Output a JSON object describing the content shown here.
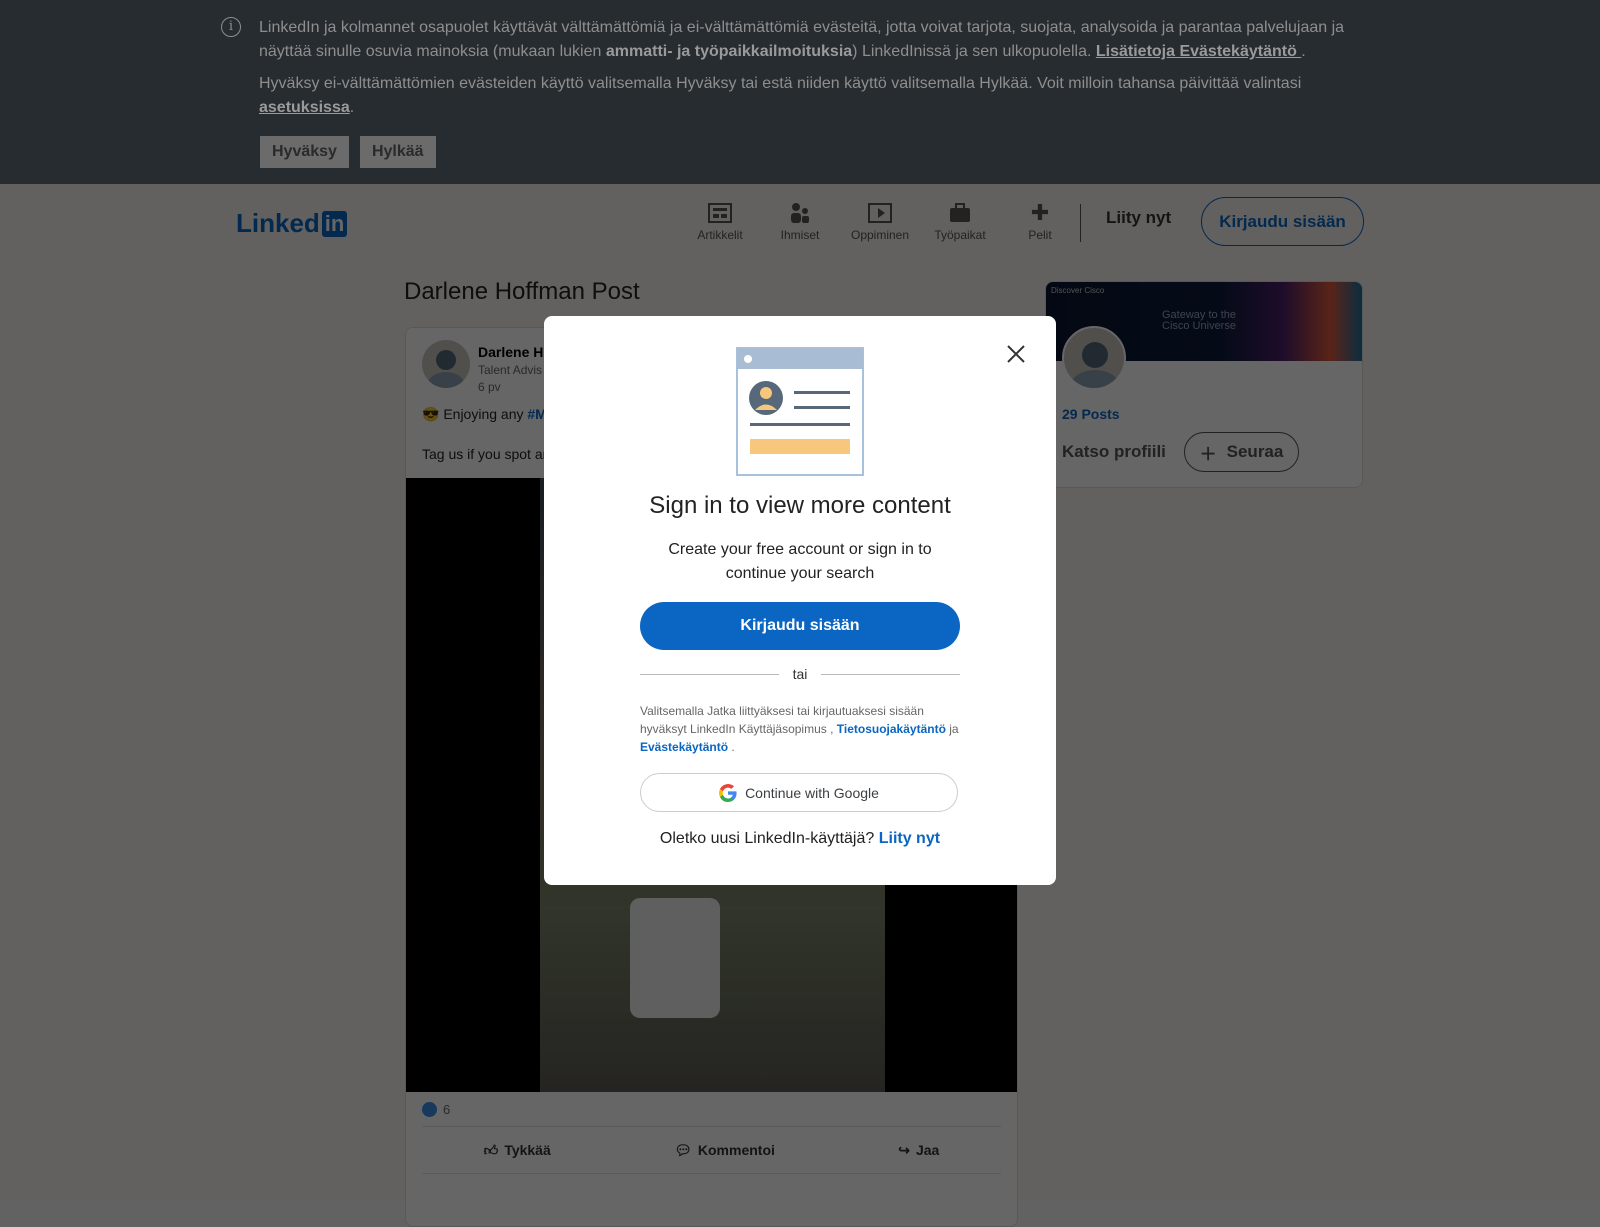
{
  "cookie_banner": {
    "text1_a": "LinkedIn ja kolmannet osapuolet käyttävät välttämättömiä ja ei-välttämättömiä evästeitä, jotta voivat tarjota, suojata, analysoida ja parantaa palvelujaan ja näyttää sinulle osuvia mainoksia (mukaan lukien ",
    "text1_bold": "ammatti- ja työpaikkailmoituksia",
    "text1_b": ") LinkedInissä ja sen ulkopuolella. ",
    "learn_more_link": "Lisätietoja Evästekäytäntö ",
    "text2": "Hyväksy ei-välttämättömien evästeiden käyttö valitsemalla Hyväksy tai estä niiden käyttö valitsemalla Hylkää. Voit milloin tahansa päivittää valintasi ",
    "settings_link": "asetuksissa",
    "accept": "Hyväksy",
    "reject": "Hylkää"
  },
  "header": {
    "logo_text": "Linked",
    "logo_in": "in",
    "nav": [
      {
        "label": "Artikkelit",
        "icon": "articles-icon"
      },
      {
        "label": "Ihmiset",
        "icon": "people-icon"
      },
      {
        "label": "Oppiminen",
        "icon": "learning-icon"
      },
      {
        "label": "Työpaikat",
        "icon": "jobs-icon"
      },
      {
        "label": "Pelit",
        "icon": "games-icon"
      }
    ],
    "join": "Liity nyt",
    "sign_in": "Kirjaudu sisään"
  },
  "post": {
    "page_title": "Darlene Hoffman Post",
    "author": "Darlene H",
    "headline": "Talent Advis",
    "time": "6 pv",
    "text_emoji": "😎",
    "text_start": " Enjoying any ",
    "hashtag": "#M",
    "text_line2": "Tag us if you spot ar",
    "reactions": "6",
    "actions": {
      "like": "Tykkää",
      "comment": "Kommentoi",
      "share": "Jaa"
    }
  },
  "sidebar": {
    "banner_small": "Discover Cisco",
    "banner_title": "Gateway to the Cisco Universe",
    "posts": "29 Posts",
    "view_profile": "Katso profiili",
    "follow": "Seuraa"
  },
  "modal": {
    "title": "Sign in to view more content",
    "subtitle": "Create your free account or sign in to continue your search",
    "sign_in": "Kirjaudu sisään",
    "or": "tai",
    "legal_a": "Valitsemalla Jatka liittyäksesi tai kirjautuaksesi sisään hyväksyt LinkedIn Käyttäjäsopimus , ",
    "privacy_link": "Tietosuojakäytäntö",
    "legal_b": " ja ",
    "cookie_link": "Evästekäytäntö",
    "legal_c": " .",
    "google": "Continue with Google",
    "new_user": "Oletko uusi LinkedIn-käyttäjä? ",
    "join": "Liity nyt"
  },
  "colors": {
    "brand": "#0a66c2",
    "banner_bg": "#272c31"
  }
}
